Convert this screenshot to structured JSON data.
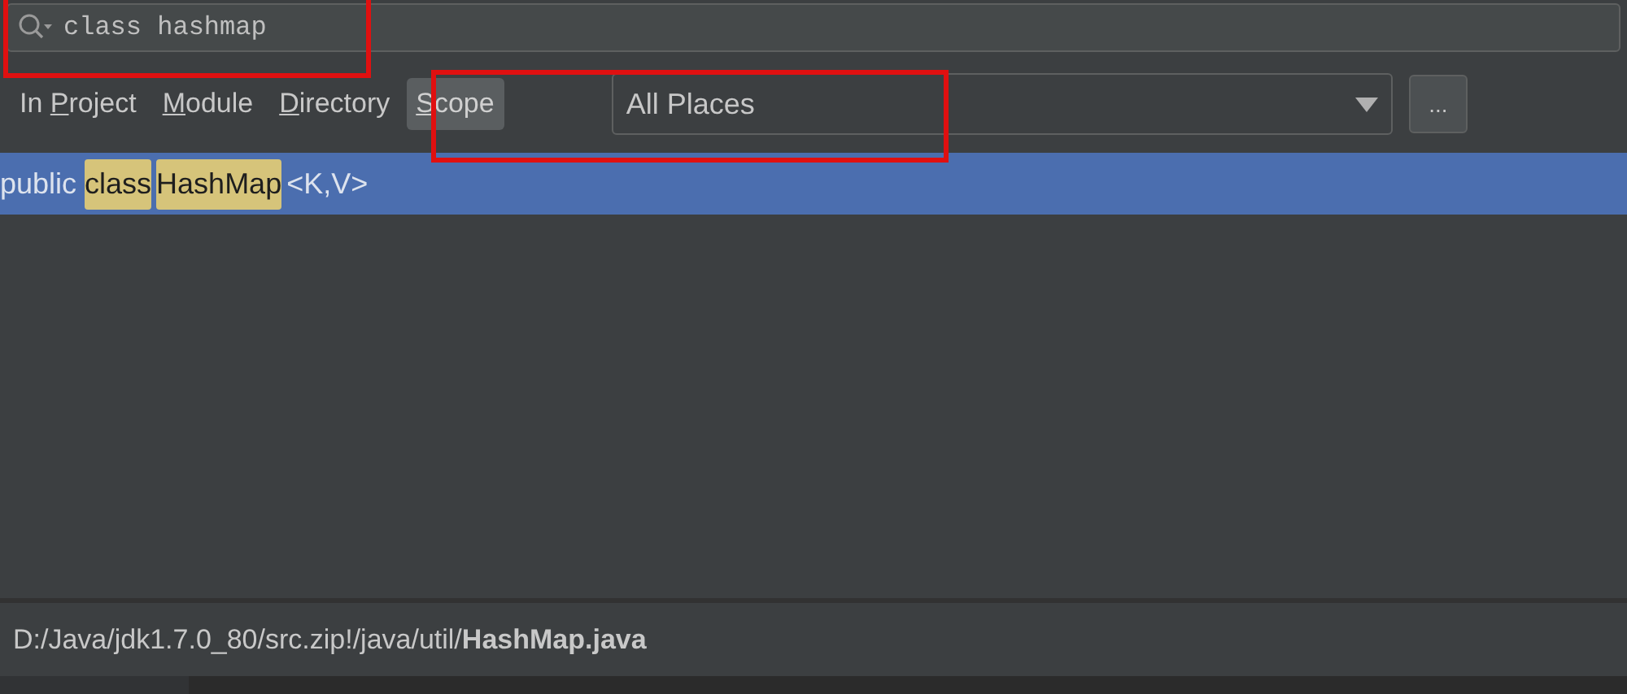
{
  "search": {
    "value": "class hashmap"
  },
  "scope_tabs": [
    {
      "prefix": "In ",
      "key": "P",
      "rest": "roject",
      "selected": false
    },
    {
      "key": "M",
      "rest": "odule",
      "selected": false
    },
    {
      "key": "D",
      "rest": "irectory",
      "selected": false
    },
    {
      "key": "S",
      "rest": "cope",
      "selected": true
    }
  ],
  "scope_dropdown": {
    "value": "All Places"
  },
  "more_button": {
    "label": "..."
  },
  "results": [
    {
      "selected": true,
      "segments": [
        {
          "text": "public ",
          "highlighted": false
        },
        {
          "text": "class",
          "highlighted": true
        },
        {
          "text": "HashMap",
          "highlighted": true
        },
        {
          "text": "<K,V>",
          "highlighted": false
        }
      ]
    }
  ],
  "file_path": "D:/Java/jdk1.7.0_80/src.zip!/java/util/**HashMap.java**"
}
